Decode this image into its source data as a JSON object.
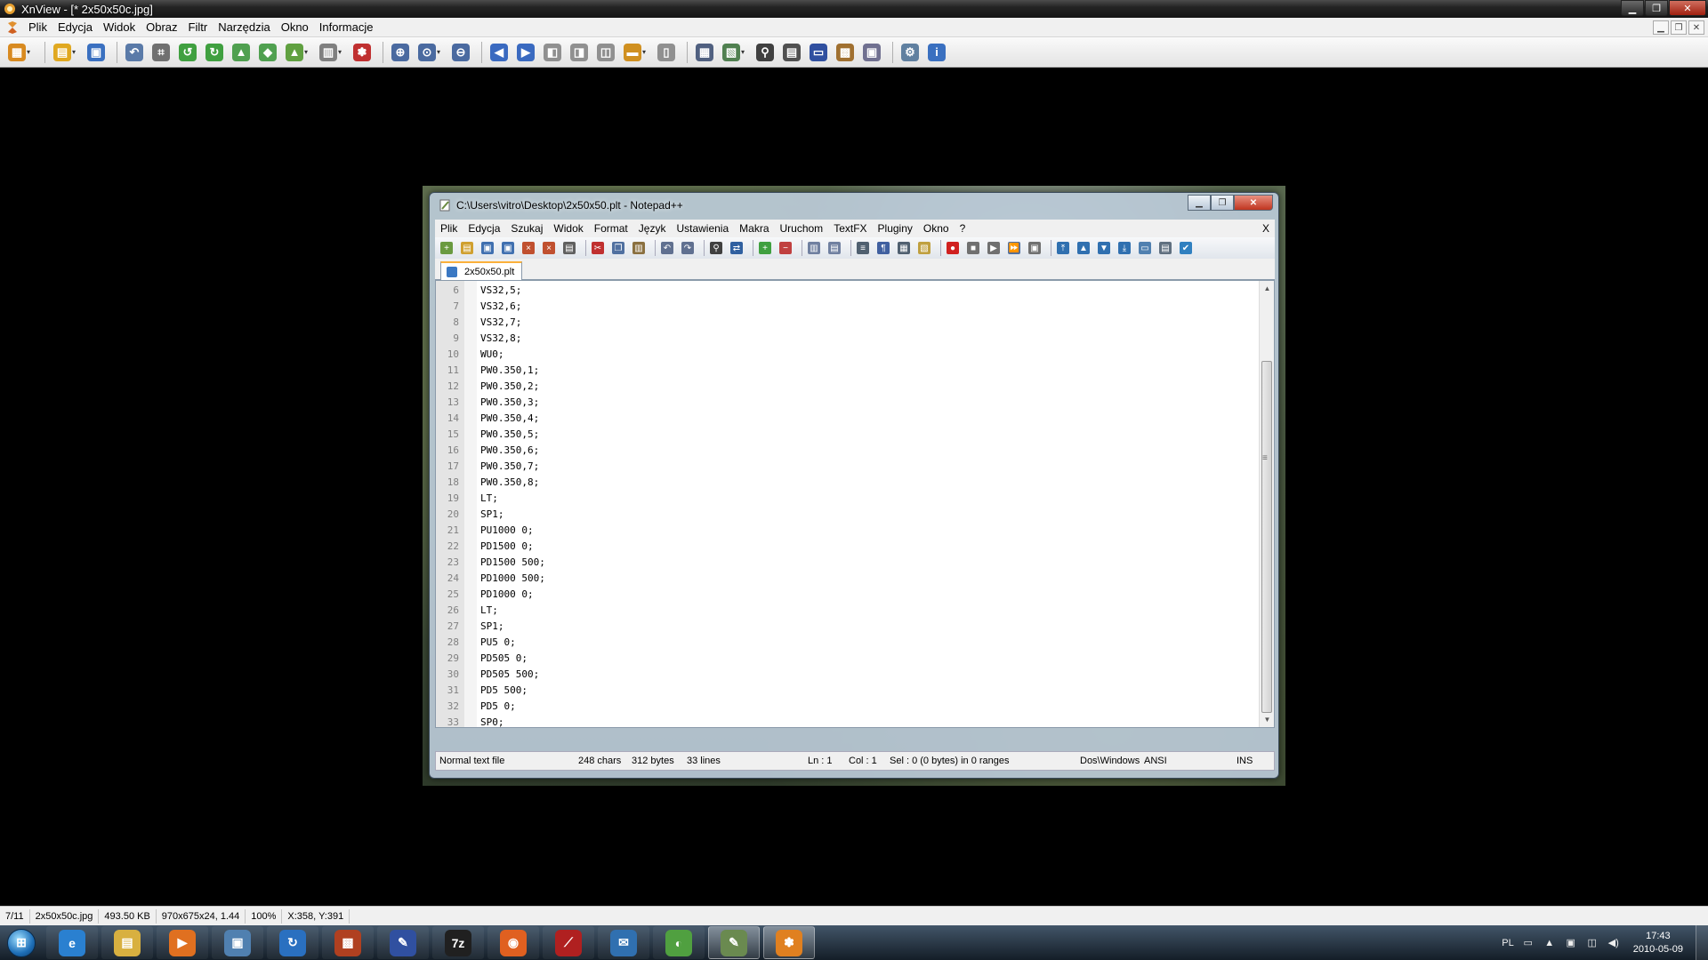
{
  "xnview": {
    "title": "XnView - [* 2x50x50c.jpg]",
    "menu": [
      "Plik",
      "Edycja",
      "Widok",
      "Obraz",
      "Filtr",
      "Narzędzia",
      "Okno",
      "Informacje"
    ],
    "toolbar_icons": [
      {
        "name": "browser-icon",
        "glyph": "▦",
        "color": "#d88a20",
        "drop": true
      },
      {
        "sep": true
      },
      {
        "name": "open-icon",
        "glyph": "▤",
        "color": "#e0a820",
        "drop": true
      },
      {
        "name": "save-icon",
        "glyph": "▣",
        "color": "#3a70c0"
      },
      {
        "sep": true
      },
      {
        "name": "undo-icon",
        "glyph": "↶",
        "color": "#5a7aa8"
      },
      {
        "name": "crop-icon",
        "glyph": "⌗",
        "color": "#707070"
      },
      {
        "name": "rotate-left-icon",
        "glyph": "↺",
        "color": "#40a040"
      },
      {
        "name": "rotate-right-icon",
        "glyph": "↻",
        "color": "#40a040"
      },
      {
        "name": "adjust-icon",
        "glyph": "▲",
        "color": "#50a050"
      },
      {
        "name": "export-icon",
        "glyph": "◆",
        "color": "#50a050"
      },
      {
        "name": "convert-icon",
        "glyph": "▲",
        "color": "#60a040",
        "drop": true
      },
      {
        "name": "color-palette-icon",
        "glyph": "▥",
        "color": "#808080",
        "drop": true
      },
      {
        "name": "effects-icon",
        "glyph": "✽",
        "color": "#c03030"
      },
      {
        "sep": true
      },
      {
        "name": "zoom-in-icon",
        "glyph": "⊕",
        "color": "#4a6aa0"
      },
      {
        "name": "zoom-icon",
        "glyph": "⊙",
        "color": "#4a6aa0",
        "drop": true
      },
      {
        "name": "zoom-out-icon",
        "glyph": "⊖",
        "color": "#4a6aa0"
      },
      {
        "sep": true
      },
      {
        "name": "previous-icon",
        "glyph": "◀",
        "color": "#3a6ac0"
      },
      {
        "name": "next-icon",
        "glyph": "▶",
        "color": "#3a6ac0"
      },
      {
        "name": "first-icon",
        "glyph": "◧",
        "color": "#909090"
      },
      {
        "name": "last-icon",
        "glyph": "◨",
        "color": "#909090"
      },
      {
        "name": "fullscreen-icon",
        "glyph": "◫",
        "color": "#909090"
      },
      {
        "name": "slideshow-icon",
        "glyph": "▬",
        "color": "#d09020",
        "drop": true
      },
      {
        "name": "compare-icon",
        "glyph": "▯",
        "color": "#909090"
      },
      {
        "sep": true
      },
      {
        "name": "fit-icon",
        "glyph": "▦",
        "color": "#506080"
      },
      {
        "name": "batch-icon",
        "glyph": "▧",
        "color": "#508050",
        "drop": true
      },
      {
        "name": "search-icon",
        "glyph": "⚲",
        "color": "#404040"
      },
      {
        "name": "print-icon",
        "glyph": "▤",
        "color": "#505050"
      },
      {
        "name": "scanner-icon",
        "glyph": "▭",
        "color": "#3050a0"
      },
      {
        "name": "wallpaper-icon",
        "glyph": "▩",
        "color": "#a07030"
      },
      {
        "name": "capture-icon",
        "glyph": "▣",
        "color": "#707090"
      },
      {
        "sep": true
      },
      {
        "name": "settings-icon",
        "glyph": "⚙",
        "color": "#6080a0"
      },
      {
        "name": "info-icon",
        "glyph": "i",
        "color": "#3a70c0"
      }
    ],
    "status": [
      "7/11",
      "2x50x50c.jpg",
      "493.50 KB",
      "970x675x24, 1.44",
      "100%",
      "X:358, Y:391"
    ]
  },
  "notepad": {
    "title": "C:\\Users\\vitro\\Desktop\\2x50x50.plt - Notepad++",
    "menu": [
      "Plik",
      "Edycja",
      "Szukaj",
      "Widok",
      "Format",
      "Język",
      "Ustawienia",
      "Makra",
      "Uruchom",
      "TextFX",
      "Pluginy",
      "Okno",
      "?"
    ],
    "menu_close": "X",
    "tab_label": "2x50x50.plt",
    "toolbar_icons": [
      {
        "name": "new-file-icon",
        "glyph": "+",
        "color": "#6a9a40"
      },
      {
        "name": "open-file-icon",
        "glyph": "▤",
        "color": "#d0a030"
      },
      {
        "name": "save-file-icon",
        "glyph": "▣",
        "color": "#4070b0"
      },
      {
        "name": "save-all-icon",
        "glyph": "▣",
        "color": "#4070b0"
      },
      {
        "name": "close-file-icon",
        "glyph": "×",
        "color": "#c05030"
      },
      {
        "name": "close-all-icon",
        "glyph": "×",
        "color": "#c05030"
      },
      {
        "name": "print-file-icon",
        "glyph": "▤",
        "color": "#606060"
      },
      {
        "sep": true
      },
      {
        "name": "cut-icon",
        "glyph": "✂",
        "color": "#c03030"
      },
      {
        "name": "copy-icon",
        "glyph": "❐",
        "color": "#5070a0"
      },
      {
        "name": "paste-icon",
        "glyph": "▥",
        "color": "#8a7040"
      },
      {
        "sep": true
      },
      {
        "name": "undo-edit-icon",
        "glyph": "↶",
        "color": "#607090"
      },
      {
        "name": "redo-edit-icon",
        "glyph": "↷",
        "color": "#607090"
      },
      {
        "sep": true
      },
      {
        "name": "find-icon",
        "glyph": "⚲",
        "color": "#404040"
      },
      {
        "name": "replace-icon",
        "glyph": "⇄",
        "color": "#3060a0"
      },
      {
        "sep": true
      },
      {
        "name": "zoom-in-text-icon",
        "glyph": "+",
        "color": "#40a040"
      },
      {
        "name": "zoom-out-text-icon",
        "glyph": "−",
        "color": "#c04040"
      },
      {
        "sep": true
      },
      {
        "name": "sync-vertical-icon",
        "glyph": "▥",
        "color": "#7080a0"
      },
      {
        "name": "sync-horizontal-icon",
        "glyph": "▤",
        "color": "#7080a0"
      },
      {
        "sep": true
      },
      {
        "name": "word-wrap-icon",
        "glyph": "≡",
        "color": "#506070"
      },
      {
        "name": "show-symbols-icon",
        "glyph": "¶",
        "color": "#4060a0"
      },
      {
        "name": "indent-guide-icon",
        "glyph": "▦",
        "color": "#506070"
      },
      {
        "name": "panel-icon",
        "glyph": "▧",
        "color": "#c0a040"
      },
      {
        "sep": true
      },
      {
        "name": "record-macro-icon",
        "glyph": "●",
        "color": "#d02020"
      },
      {
        "name": "stop-macro-icon",
        "glyph": "■",
        "color": "#707070"
      },
      {
        "name": "play-macro-icon",
        "glyph": "▶",
        "color": "#707070"
      },
      {
        "name": "run-macro-icon",
        "glyph": "⏩",
        "color": "#5070a0"
      },
      {
        "name": "save-macro-icon",
        "glyph": "▣",
        "color": "#707070"
      },
      {
        "sep": true
      },
      {
        "name": "move-top-icon",
        "glyph": "⤒",
        "color": "#3070b0"
      },
      {
        "name": "move-up-icon",
        "glyph": "▲",
        "color": "#3070b0"
      },
      {
        "name": "move-down-icon",
        "glyph": "▼",
        "color": "#3070b0"
      },
      {
        "name": "move-bottom-icon",
        "glyph": "⤓",
        "color": "#3070b0"
      },
      {
        "name": "window-icon",
        "glyph": "▭",
        "color": "#5080b0"
      },
      {
        "name": "doc-map-icon",
        "glyph": "▤",
        "color": "#607080"
      },
      {
        "name": "spellcheck-icon",
        "glyph": "✔",
        "color": "#3080c0"
      }
    ],
    "lines": [
      {
        "n": "6",
        "t": "VS32,5;"
      },
      {
        "n": "7",
        "t": "VS32,6;"
      },
      {
        "n": "8",
        "t": "VS32,7;"
      },
      {
        "n": "9",
        "t": "VS32,8;"
      },
      {
        "n": "10",
        "t": "WU0;"
      },
      {
        "n": "11",
        "t": "PW0.350,1;"
      },
      {
        "n": "12",
        "t": "PW0.350,2;"
      },
      {
        "n": "13",
        "t": "PW0.350,3;"
      },
      {
        "n": "14",
        "t": "PW0.350,4;"
      },
      {
        "n": "15",
        "t": "PW0.350,5;"
      },
      {
        "n": "16",
        "t": "PW0.350,6;"
      },
      {
        "n": "17",
        "t": "PW0.350,7;"
      },
      {
        "n": "18",
        "t": "PW0.350,8;"
      },
      {
        "n": "19",
        "t": "LT;"
      },
      {
        "n": "20",
        "t": "SP1;"
      },
      {
        "n": "21",
        "t": "PU1000 0;"
      },
      {
        "n": "22",
        "t": "PD1500 0;"
      },
      {
        "n": "23",
        "t": "PD1500 500;"
      },
      {
        "n": "24",
        "t": "PD1000 500;"
      },
      {
        "n": "25",
        "t": "PD1000 0;"
      },
      {
        "n": "26",
        "t": "LT;"
      },
      {
        "n": "27",
        "t": "SP1;"
      },
      {
        "n": "28",
        "t": "PU5 0;"
      },
      {
        "n": "29",
        "t": "PD505 0;"
      },
      {
        "n": "30",
        "t": "PD505 500;"
      },
      {
        "n": "31",
        "t": "PD5 500;"
      },
      {
        "n": "32",
        "t": "PD5 0;"
      },
      {
        "n": "33",
        "t": "SP0;"
      }
    ],
    "status": {
      "file_type": "Normal text file",
      "chars": "248 chars",
      "bytes": "312 bytes",
      "lines": "33 lines",
      "ln": "Ln : 1",
      "col": "Col : 1",
      "sel": "Sel : 0 (0 bytes) in 0 ranges",
      "eol": "Dos\\Windows",
      "encoding": "ANSI",
      "mode": "INS"
    }
  },
  "taskbar": {
    "apps": [
      {
        "name": "internet-explorer-icon",
        "glyph": "e",
        "color": "#2a80d0",
        "state": "pinned"
      },
      {
        "name": "explorer-icon",
        "glyph": "▤",
        "color": "#d8b040",
        "state": "pinned"
      },
      {
        "name": "media-player-icon",
        "glyph": "▶",
        "color": "#e07020",
        "state": "pinned"
      },
      {
        "name": "mycomputer-icon",
        "glyph": "▣",
        "color": "#5080b0",
        "state": "pinned"
      },
      {
        "name": "sync-icon",
        "glyph": "↻",
        "color": "#2a70c0",
        "state": "pinned"
      },
      {
        "name": "archive-icon",
        "glyph": "▩",
        "color": "#b04020",
        "state": "pinned"
      },
      {
        "name": "pen-icon",
        "glyph": "✎",
        "color": "#3050a0",
        "state": "pinned"
      },
      {
        "name": "7zip-icon",
        "glyph": "7z",
        "color": "#202020",
        "state": "pinned"
      },
      {
        "name": "firefox-icon",
        "glyph": "◉",
        "color": "#e06020",
        "state": "pinned"
      },
      {
        "name": "pdf-icon",
        "glyph": "⟋",
        "color": "#b02020",
        "state": "pinned"
      },
      {
        "name": "thunderbird-icon",
        "glyph": "✉",
        "color": "#3070b0",
        "state": "pinned"
      },
      {
        "name": "corel-icon",
        "glyph": "◐",
        "color": "#50a040",
        "state": "pinned"
      },
      {
        "name": "notepad-icon",
        "glyph": "✎",
        "color": "#6a8a50",
        "state": "active"
      },
      {
        "name": "xnview-icon",
        "glyph": "✽",
        "color": "#e08020",
        "state": "active"
      }
    ],
    "tray": {
      "lang": "PL",
      "time": "17:43",
      "date": "2010-05-09"
    }
  }
}
